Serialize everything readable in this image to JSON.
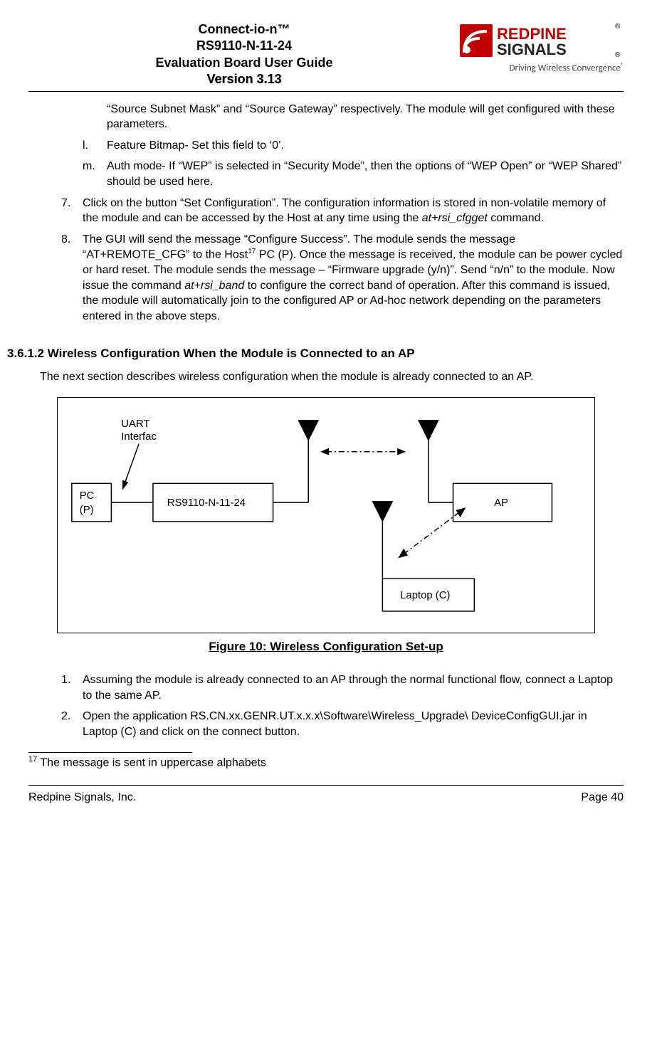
{
  "header": {
    "line1": "Connect-io-n™",
    "line2": "RS9110-N-11-24",
    "line3": "Evaluation Board User Guide",
    "version": "Version 3.13",
    "logo_top": "REDPINE",
    "logo_bottom": "SIGNALS",
    "tagline": "Driving Wireless Convergence",
    "reg": "®"
  },
  "continuation": {
    "text": "“Source Subnet Mask”  and “Source Gateway” respectively. The module will get configured with these parameters."
  },
  "alpha_items": [
    {
      "marker": "l.",
      "text": "Feature Bitmap- Set this field to ‘0’."
    },
    {
      "marker": "m.",
      "text": "Auth mode- If “WEP” is selected in “Security Mode”, then the options of “WEP Open” or “WEP Shared” should be used here."
    }
  ],
  "num_items": {
    "seven": {
      "marker": "7.",
      "pre": "Click on the button “Set Configuration”.  The configuration information is stored in non-volatile memory of the module and can be accessed by the Host at any time using the ",
      "cmd": "at+rsi_cfgget",
      "post": " command."
    },
    "eight": {
      "marker": "8.",
      "pre": "The GUI will send the message “Configure Success”. The module sends the message “AT+REMOTE_CFG” to the Host",
      "sup": "17",
      "mid": " PC (P). Once the message is received, the module can be power cycled or hard reset. The module sends the message – “Firmware upgrade (y/n)”. Send “n/n” to the module. Now issue the command ",
      "cmd": "at+rsi_band",
      "post": " to configure the correct band of operation. After this command is issued, the module will automatically join to the configured AP or Ad-hoc network depending on the parameters entered in the above steps."
    }
  },
  "section": {
    "heading": "3.6.1.2 Wireless Configuration When the Module is Connected to an AP",
    "intro": "The next section describes wireless configuration when the module is already connected to an AP."
  },
  "diagram": {
    "uart": "UART Interfac",
    "pc": "PC (P)",
    "module": "RS9110-N-11-24",
    "ap": "AP",
    "laptop": "Laptop (C)"
  },
  "figure_caption": "Figure 10: Wireless Configuration Set-up",
  "steps": [
    {
      "marker": "1.",
      "text": "Assuming the module is already connected to an AP through the normal functional flow, connect a Laptop to the same AP."
    },
    {
      "marker": "2.",
      "text": "Open the application RS.CN.xx.GENR.UT.x.x.x\\Software\\Wireless_Upgrade\\ DeviceConfigGUI.jar in Laptop (C) and click on the connect button."
    }
  ],
  "footnote": {
    "num": "17",
    "text": " The message is sent in uppercase alphabets"
  },
  "footer": {
    "left": "Redpine Signals, Inc.",
    "right": "Page 40"
  }
}
